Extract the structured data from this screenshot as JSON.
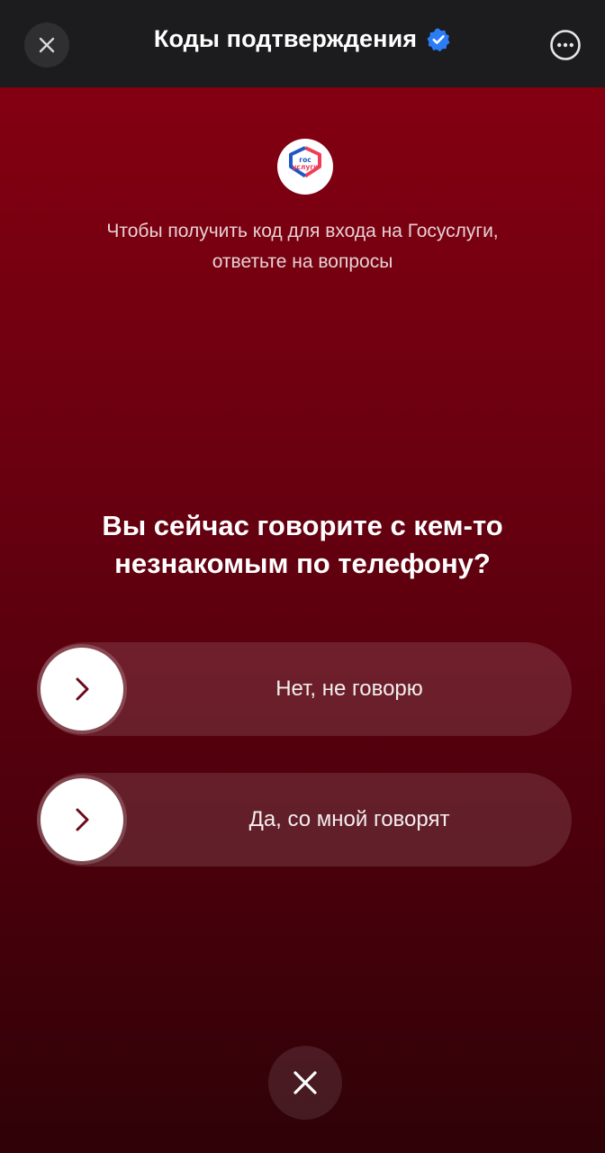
{
  "header": {
    "title": "Коды подтверждения",
    "close_icon": "close-icon",
    "verified_icon": "verified-badge-icon",
    "more_icon": "more-options-icon",
    "verified_color": "#2c7cf6"
  },
  "logo": {
    "text_line1": "гос",
    "text_line2": "услуги",
    "brand_blue": "#1f57c3",
    "brand_red": "#ee3f58"
  },
  "intro": {
    "line1": "Чтобы получить код для входа на Госуслуги,",
    "line2": "ответьте на вопросы"
  },
  "question": {
    "line1": "Вы сейчас говорите с кем-то",
    "line2": "незнакомым по телефону?"
  },
  "options": [
    {
      "label": "Нет, не говорю",
      "icon": "chevron-right-icon"
    },
    {
      "label": "Да, со мной говорят",
      "icon": "chevron-right-icon"
    }
  ],
  "dismiss": {
    "icon": "close-icon"
  },
  "colors": {
    "background_top": "#830011",
    "background_bottom": "#2e0207",
    "chevron": "#6b0a1a"
  }
}
